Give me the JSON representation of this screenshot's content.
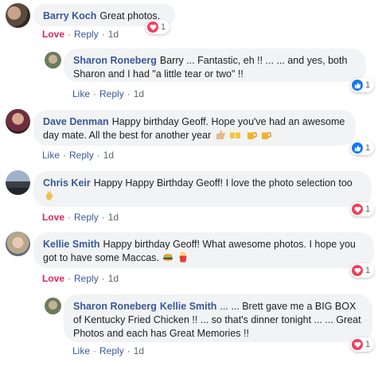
{
  "comments": [
    {
      "author": "Barry Koch",
      "text": "Great photos.",
      "actions": {
        "react_label": "Love",
        "reply": "Reply",
        "time": "1d"
      },
      "reaction": {
        "type": "love",
        "count": "1"
      }
    },
    {
      "author": "Sharon Roneberg",
      "text": "Barry ... Fantastic, eh !! ... ... and yes, both Sharon and I had \"a little tear or two\" !!",
      "actions": {
        "react_label": "Like",
        "reply": "Reply",
        "time": "1d"
      },
      "reaction": {
        "type": "like",
        "count": "1"
      }
    },
    {
      "author": "Dave Denman",
      "text": "Happy birthday Geoff. Hope you've had an awesome day mate. All the best for another year",
      "actions": {
        "react_label": "Like",
        "reply": "Reply",
        "time": "1d"
      },
      "reaction": {
        "type": "like",
        "count": "1"
      }
    },
    {
      "author": "Chris Keir",
      "text": "Happy Happy Birthday Geoff! I love the photo selection too",
      "actions": {
        "react_label": "Love",
        "reply": "Reply",
        "time": "1d"
      },
      "reaction": {
        "type": "love",
        "count": "1"
      }
    },
    {
      "author": "Kellie Smith",
      "text": "Happy birthday Geoff! What awesome photos. I hope you got to have some Maccas.",
      "actions": {
        "react_label": "Love",
        "reply": "Reply",
        "time": "1d"
      },
      "reaction": {
        "type": "love",
        "count": "1"
      }
    },
    {
      "author": "Sharon Roneberg",
      "mention": "Kellie Smith",
      "text": "... ... Brett gave me a BIG BOX of Kentucky Fried Chicken !! ... so that's dinner tonight ... ... Great Photos and each has Great Memories !!",
      "actions": {
        "react_label": "Like",
        "reply": "Reply",
        "time": "1d"
      },
      "reaction": {
        "type": "love",
        "count": "1"
      }
    }
  ],
  "colors": {
    "link": "#385898",
    "love": "#e0245e",
    "like": "#1877f2",
    "bubble": "#f2f3f5"
  }
}
